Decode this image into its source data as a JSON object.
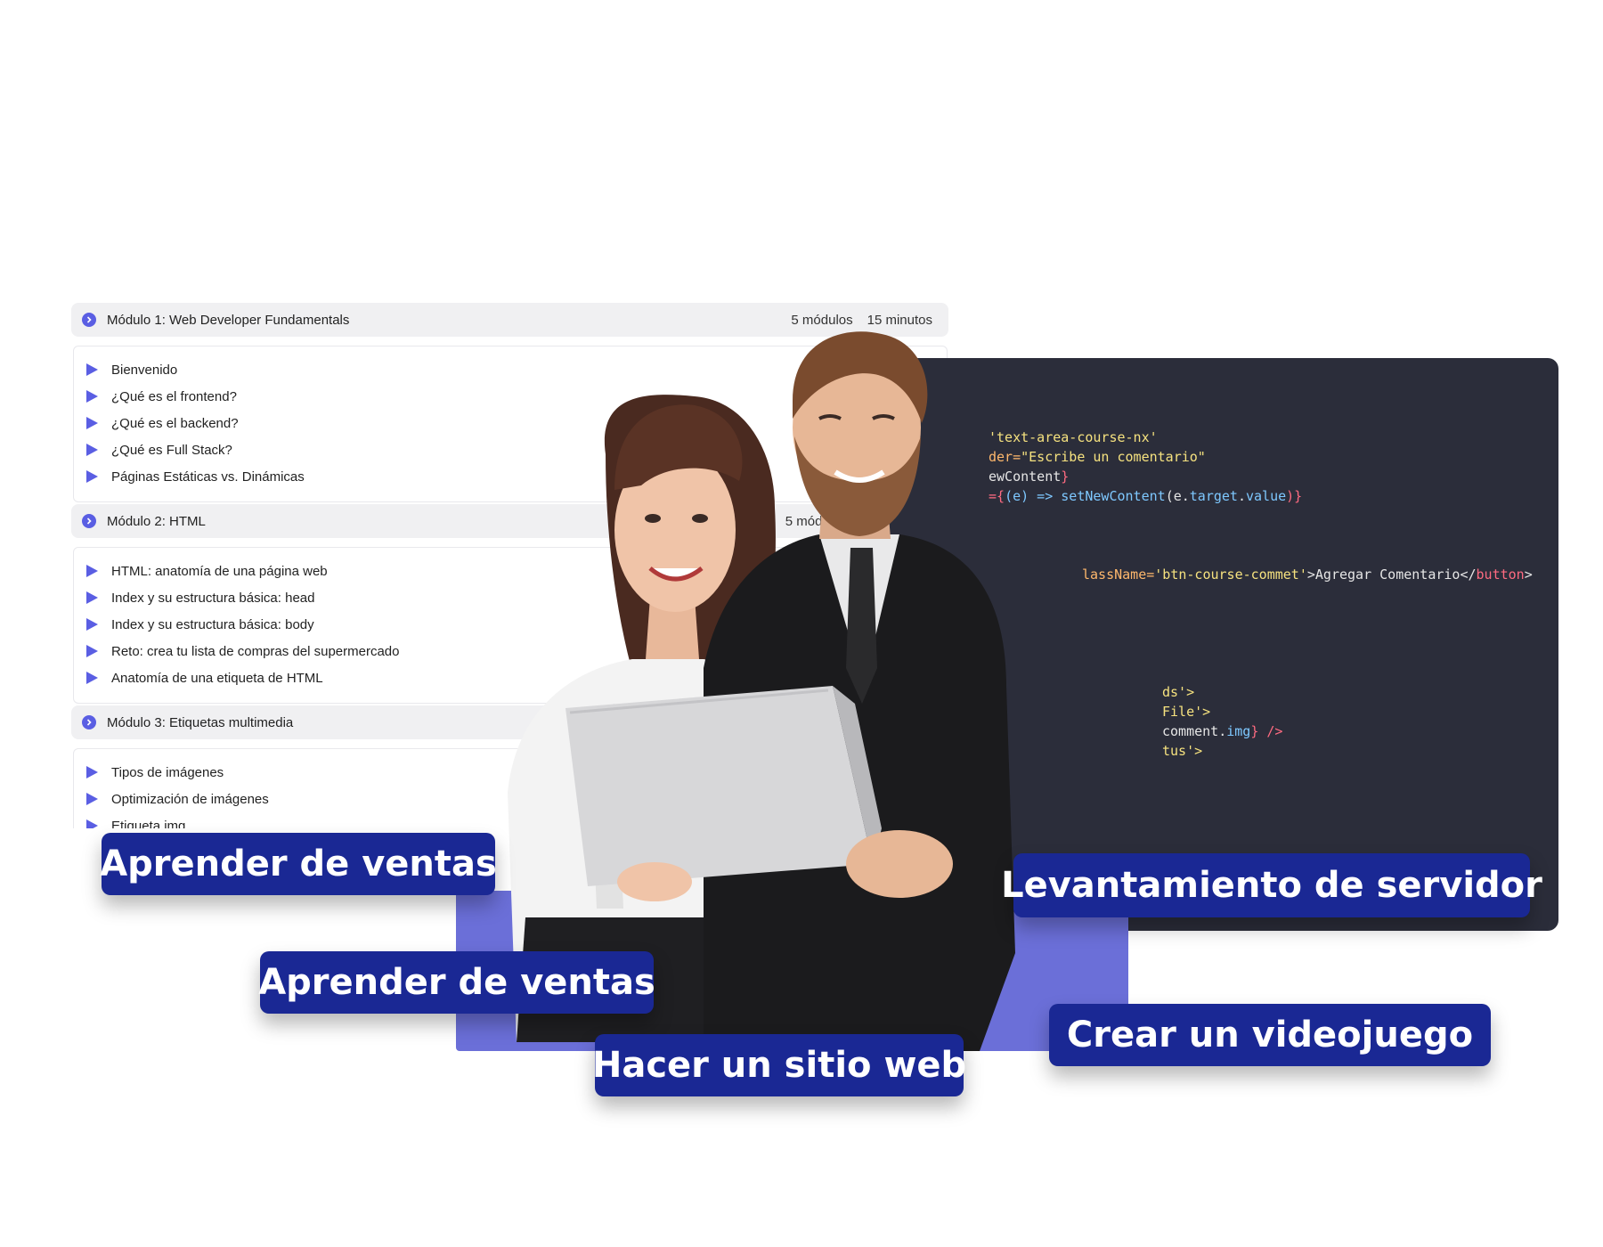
{
  "course": {
    "modules": [
      {
        "title": "Módulo 1: Web Developer Fundamentals",
        "count": "5 módulos",
        "duration": "15 minutos",
        "lessons": [
          "Bienvenido",
          "¿Qué es el frontend?",
          "¿Qué es el backend?",
          "¿Qué es Full Stack?",
          "Páginas Estáticas vs. Dinámicas"
        ]
      },
      {
        "title": "Módulo 2: HTML",
        "count": "5 módulos",
        "lessons": [
          "HTML: anatomía de una página web",
          "Index y su estructura básica: head",
          "Index y su estructura básica: body",
          "Reto: crea tu lista de compras del supermercado",
          "Anatomía de una etiqueta de HTML"
        ]
      },
      {
        "title": "Módulo 3: Etiquetas multimedia",
        "lessons": [
          "Tipos de imágenes",
          "Optimización de imágenes",
          "Etiqueta img"
        ]
      }
    ]
  },
  "code": {
    "l1": "'text-area-course-nx'",
    "l2a": "der=",
    "l2b": "\"Escribe un comentario\"",
    "l3a": "ewContent",
    "l3b": "}",
    "l4a": "={",
    "l4b": "(e) => ",
    "l4c": "setNewContent",
    "l4d": "(e.",
    "l4e": "target",
    "l4f": ".",
    "l4g": "value",
    "l4h": ")}",
    "l5a": "lassName=",
    "l5b": "'btn-course-commet'",
    "l5c": ">Agregar Comentario</",
    "l5d": "button",
    "l5e": ">",
    "l6": "ds'>",
    "l7": "File'>",
    "l8a": "comment.",
    "l8b": "img",
    "l8c": "} />",
    "l9": "tus'>"
  },
  "badges": {
    "b1": "Aprender de ventas",
    "b2": "Aprender de ventas",
    "b3": "Hacer un sitio web",
    "b4": "Levantamiento de servidor",
    "b5": "Crear un videojuego"
  },
  "colors": {
    "accent": "#5a5ee3",
    "badge": "#1a2894",
    "editor": "#2b2d3a",
    "backdrop": "#6b6fd8"
  }
}
